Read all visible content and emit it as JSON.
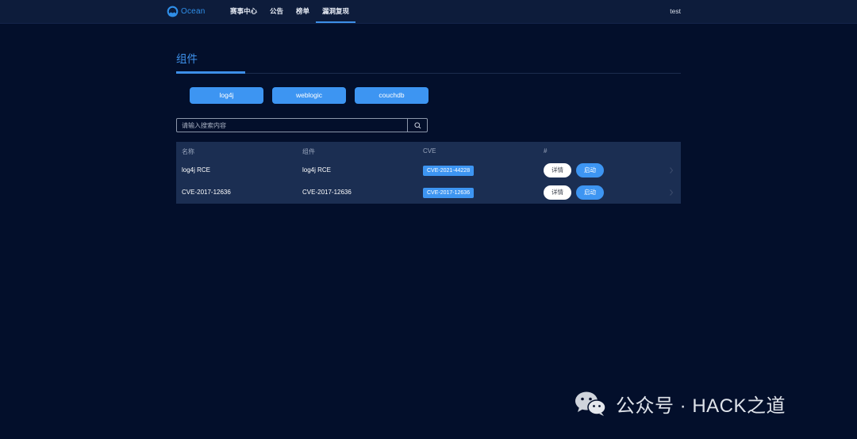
{
  "header": {
    "logo_text": "Ocean",
    "nav": [
      {
        "label": "赛事中心",
        "active": false
      },
      {
        "label": "公告",
        "active": false
      },
      {
        "label": "榜单",
        "active": false
      },
      {
        "label": "漏洞复现",
        "active": true
      }
    ],
    "user": "test"
  },
  "section": {
    "title": "组件"
  },
  "components": [
    "log4j",
    "weblogic",
    "couchdb"
  ],
  "search": {
    "placeholder": "请输入搜索内容",
    "value": ""
  },
  "table": {
    "headers": [
      "名称",
      "组件",
      "CVE",
      "#"
    ],
    "rows": [
      {
        "name": "log4j RCE",
        "component": "log4j RCE",
        "cve": "CVE-2021-44228",
        "detail_label": "详情",
        "start_label": "启动"
      },
      {
        "name": "CVE-2017-12636",
        "component": "CVE-2017-12636",
        "cve": "CVE-2017-12636",
        "detail_label": "详情",
        "start_label": "启动"
      }
    ]
  },
  "watermark": {
    "text": "公众号 · HACK之道"
  },
  "colors": {
    "background": "#030f2b",
    "topbar": "#0d1c3b",
    "accent": "#3d95f2",
    "table_bg": "#1b2e52"
  }
}
